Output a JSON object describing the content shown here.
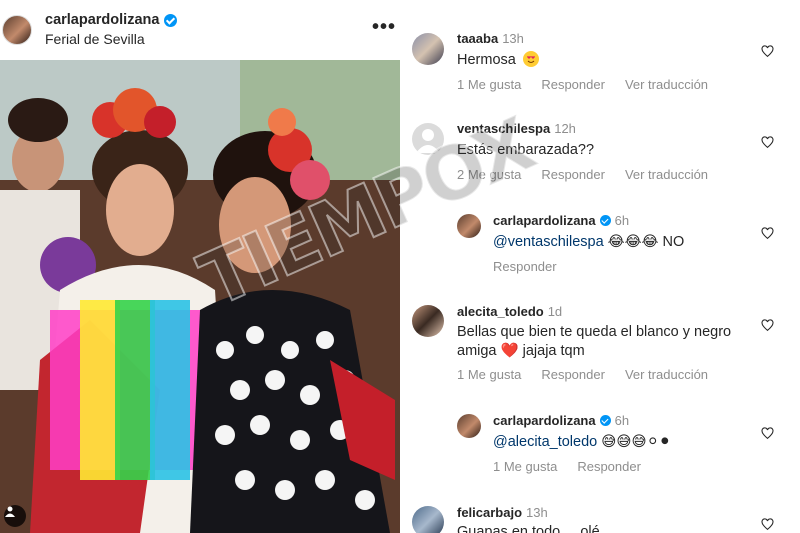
{
  "post": {
    "username": "carlapardolizana",
    "location": "Ferial de Sevilla",
    "more_icon": "more-horizontal-icon"
  },
  "comments": [
    {
      "user": "taaaba",
      "time": "13h",
      "text": "Hermosa",
      "emoji": "😍",
      "likes": "1 Me gusta",
      "reply": "Responder",
      "translate": "Ver traducción"
    },
    {
      "user": "ventaschilespa",
      "time": "12h",
      "text": "Estás embarazada??",
      "likes": "2 Me gusta",
      "reply": "Responder",
      "translate": "Ver traducción"
    },
    {
      "user": "carlapardolizana",
      "time": "6h",
      "mention": "@ventaschilespa",
      "emojis": "😂😂😂",
      "text": "NO",
      "reply": "Responder"
    },
    {
      "user": "alecita_toledo",
      "time": "1d",
      "text": "Bellas que  bien te queda el blanco y negro amiga",
      "emoji": "❤️",
      "text2": "jajaja tqm",
      "likes": "1 Me gusta",
      "reply": "Responder",
      "translate": "Ver traducción"
    },
    {
      "user": "carlapardolizana",
      "time": "6h",
      "mention": "@alecita_toledo",
      "emojis": "😅😅😅⚪⚫",
      "likes": "1 Me gusta",
      "reply": "Responder"
    },
    {
      "user": "felicarbajo",
      "time": "13h",
      "text": "Guapas en todo ... olé"
    }
  ],
  "watermark": "TIEMPOX"
}
